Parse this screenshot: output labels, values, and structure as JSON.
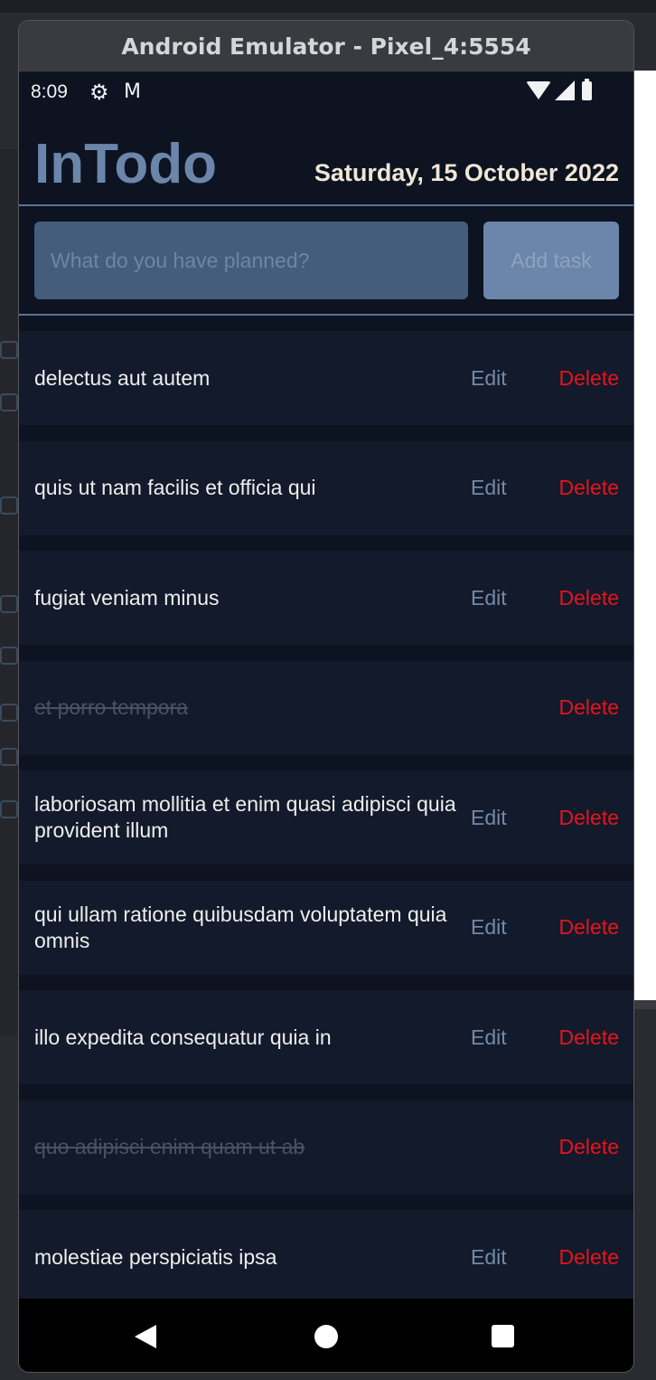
{
  "window": {
    "title": "Android Emulator - Pixel_4:5554"
  },
  "statusbar": {
    "time": "8:09",
    "icons": [
      "gear-icon",
      "gmail-icon",
      "wifi-icon",
      "signal-icon",
      "battery-icon"
    ]
  },
  "app": {
    "title": "InTodo",
    "date": "Saturday, 15 October 2022",
    "input_placeholder": "What do you have planned?",
    "input_value": "",
    "add_button_label": "Add task"
  },
  "tasks": [
    {
      "text": "delectus aut autem",
      "completed": false,
      "edit_label": "Edit",
      "delete_label": "Delete"
    },
    {
      "text": "quis ut nam facilis et officia qui",
      "completed": false,
      "edit_label": "Edit",
      "delete_label": "Delete"
    },
    {
      "text": "fugiat veniam minus",
      "completed": false,
      "edit_label": "Edit",
      "delete_label": "Delete"
    },
    {
      "text": "et porro tempora",
      "completed": true,
      "edit_label": "",
      "delete_label": "Delete"
    },
    {
      "text": "laboriosam mollitia et enim quasi adipisci quia provident illum",
      "completed": false,
      "edit_label": "Edit",
      "delete_label": "Delete"
    },
    {
      "text": "qui ullam ratione quibusdam voluptatem quia omnis",
      "completed": false,
      "edit_label": "Edit",
      "delete_label": "Delete"
    },
    {
      "text": "illo expedita consequatur quia in",
      "completed": false,
      "edit_label": "Edit",
      "delete_label": "Delete"
    },
    {
      "text": "quo adipisci enim quam ut ab",
      "completed": true,
      "edit_label": "",
      "delete_label": "Delete"
    },
    {
      "text": "molestiae perspiciatis ipsa",
      "completed": false,
      "edit_label": "Edit",
      "delete_label": "Delete"
    }
  ],
  "colors": {
    "accent": "#6b86aa",
    "background": "#0d1321",
    "item_background": "#131a2b",
    "delete": "#e6141c",
    "date": "#efe6d6"
  },
  "navbar": {
    "icons": [
      "back-icon",
      "home-icon",
      "recents-icon"
    ]
  }
}
